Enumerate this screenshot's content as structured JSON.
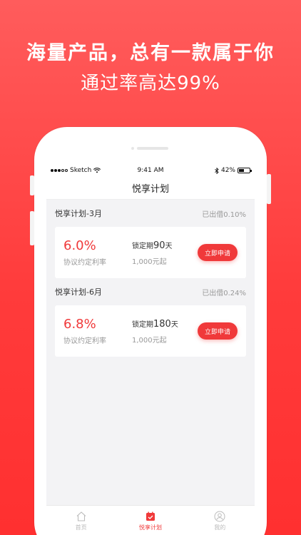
{
  "promo": {
    "headline": "海量产品，总有一款属于你",
    "subline": "通过率高达99%"
  },
  "status_bar": {
    "carrier": "Sketch",
    "time": "9:41 AM",
    "battery": "42%"
  },
  "nav": {
    "title": "悦享计划"
  },
  "plans": [
    {
      "title": "悦享计划-3月",
      "lent": "已出借0.10%",
      "rate": "6.0%",
      "rate_label": "协议约定利率",
      "term_prefix": "锁定期",
      "term_num": "90",
      "term_unit": "天",
      "min_amount": "1,000元起",
      "apply_label": "立即申请"
    },
    {
      "title": "悦享计划-6月",
      "lent": "已出借0.24%",
      "rate": "6.8%",
      "rate_label": "协议约定利率",
      "term_prefix": "锁定期",
      "term_num": "180",
      "term_unit": "天",
      "min_amount": "1,000元起",
      "apply_label": "立即申请"
    }
  ],
  "tabs": [
    {
      "label": "首页",
      "icon": "home-icon"
    },
    {
      "label": "悦享计划",
      "icon": "calendar-icon",
      "active": true
    },
    {
      "label": "我的",
      "icon": "user-icon"
    }
  ],
  "colors": {
    "accent": "#f0393a",
    "background_top": "#ff5c5c",
    "background_bottom": "#ff3030"
  }
}
